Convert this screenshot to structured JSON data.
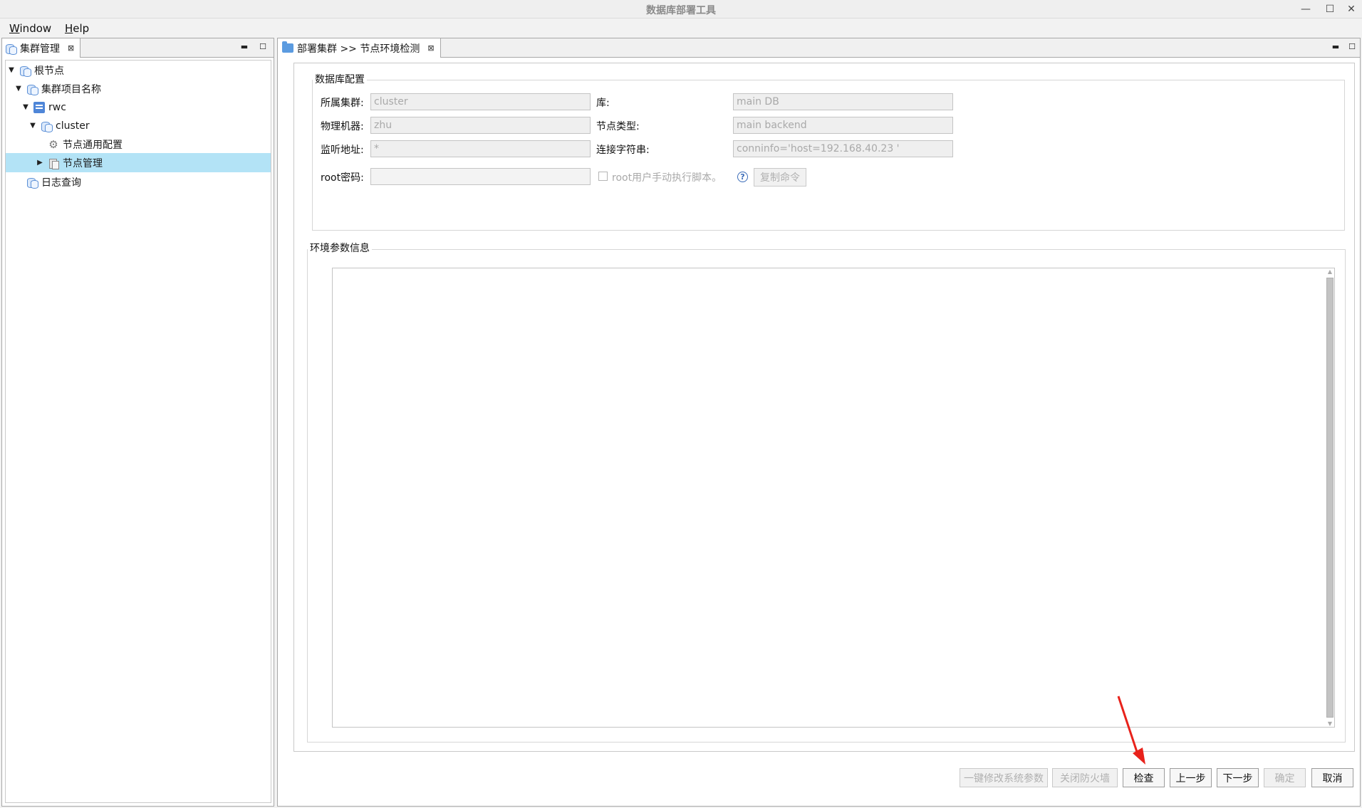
{
  "window": {
    "title": "数据库部署工具",
    "min": "—",
    "max": "☐",
    "close": "✕"
  },
  "menu": [
    {
      "mnemonic": "W",
      "rest": "indow"
    },
    {
      "mnemonic": "H",
      "rest": "elp"
    }
  ],
  "left_panel": {
    "tab_label": "集群管理",
    "tree": {
      "root": "根节点",
      "project": "集群项目名称",
      "host": "rwc",
      "cluster": "cluster",
      "general_config": "节点通用配置",
      "node_mgmt": "节点管理",
      "log_query": "日志查询"
    }
  },
  "editor": {
    "tab_label": "部署集群 >> 节点环境检测",
    "db_config": {
      "title": "数据库配置",
      "cluster_label": "所属集群:",
      "cluster_value": "cluster",
      "db_label": "库:",
      "db_value": "main DB",
      "machine_label": "物理机器:",
      "machine_value": "zhu",
      "node_type_label": "节点类型:",
      "node_type_value": "main backend",
      "listen_label": "监听地址:",
      "listen_value": "*",
      "conn_label": "连接字符串:",
      "conn_value": "conninfo='host=192.168.40.23 '",
      "root_pwd_label": "root密码:",
      "root_pwd_value": "",
      "manual_script_label": "root用户手动执行脚本。",
      "manual_script_checked": false,
      "help_glyph": "?",
      "copy_cmd": "复制命令"
    },
    "env_info": {
      "title": "环境参数信息",
      "text": ""
    },
    "buttons": {
      "modify_params": "一键修改系统参数",
      "close_firewall": "关闭防火墙",
      "check": "检查",
      "prev": "上一步",
      "next": "下一步",
      "confirm": "确定",
      "cancel": "取消"
    }
  },
  "colors": {
    "selection": "#b3e3f6",
    "annotation_arrow": "#e8221b"
  }
}
